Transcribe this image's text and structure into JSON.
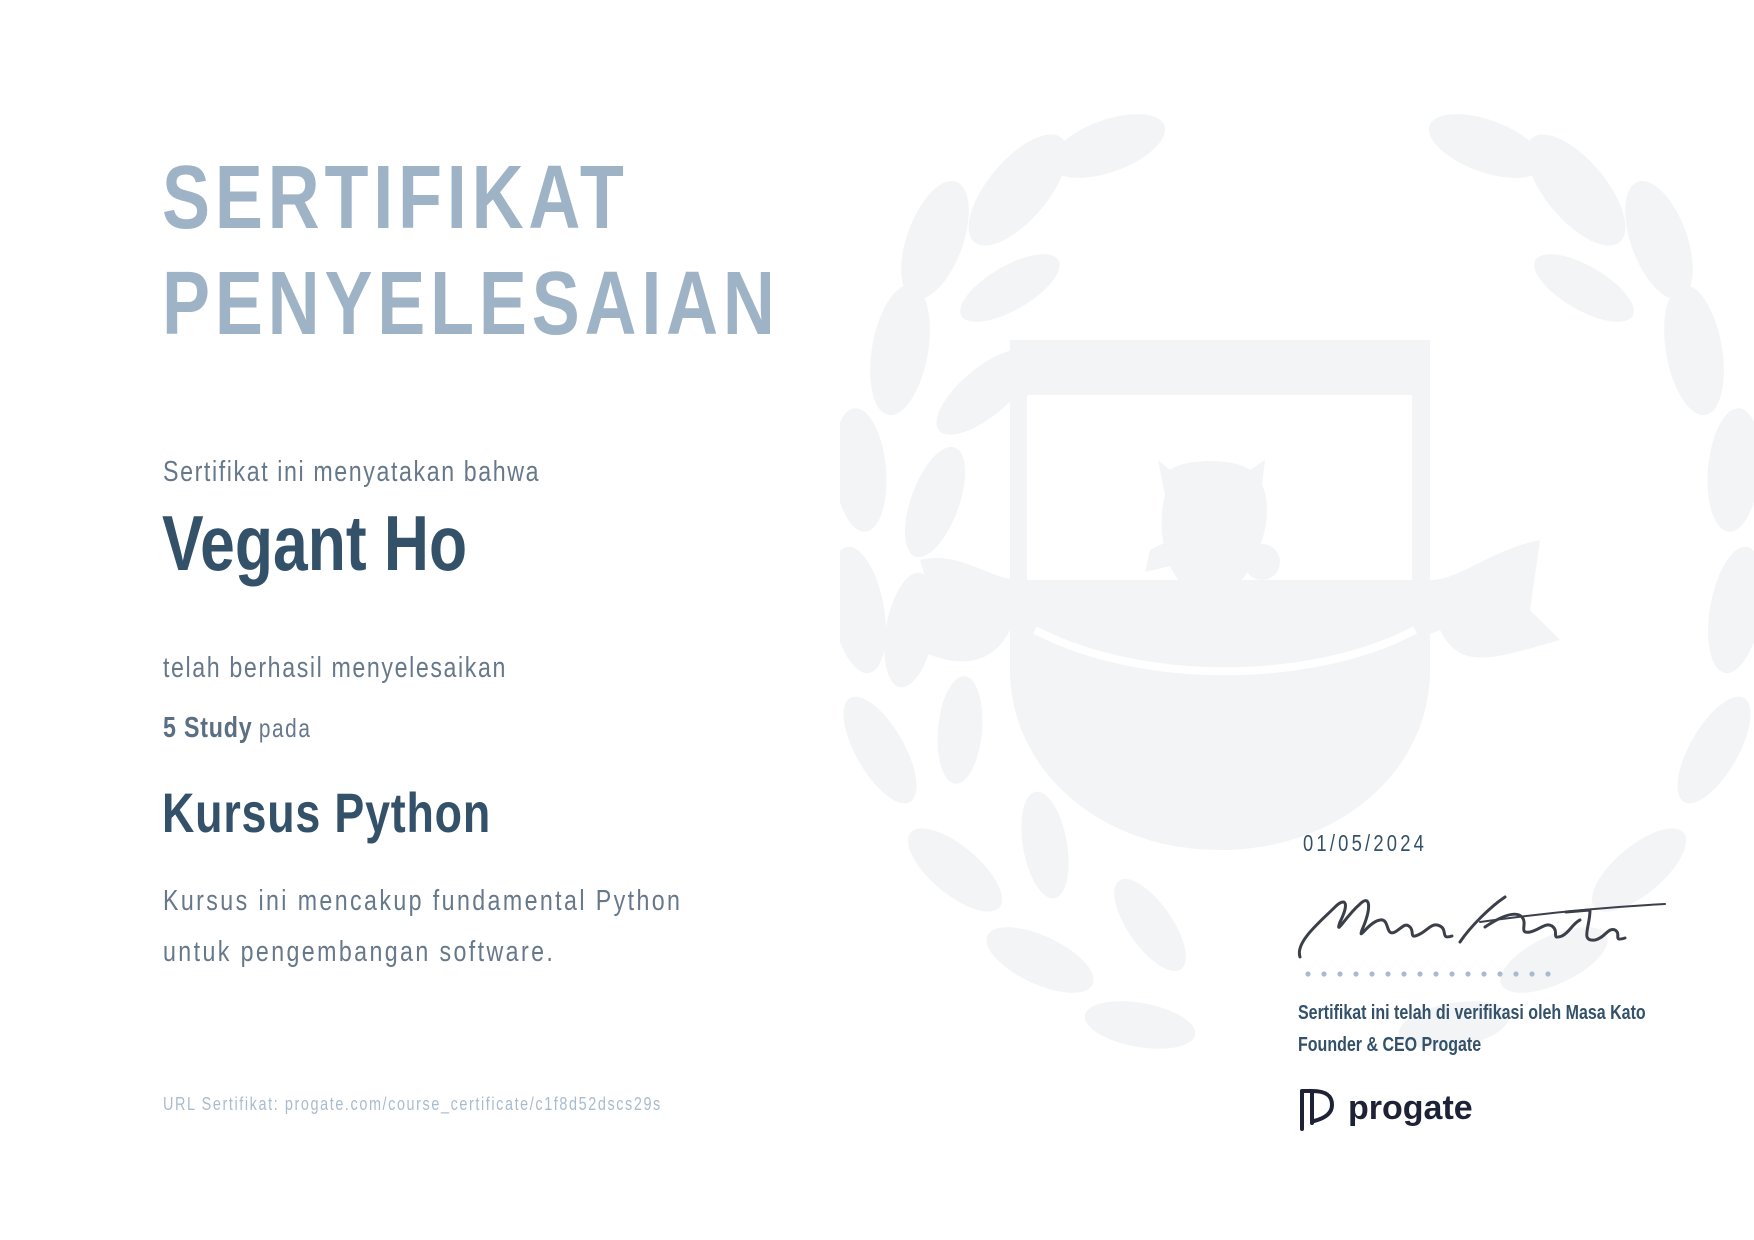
{
  "certificate": {
    "title_line1": "SERTIFIKAT",
    "title_line2": "PENYELESAIAN",
    "intro": "Sertifikat ini menyatakan bahwa",
    "recipient": "Vegant Ho",
    "completed_text": "telah berhasil menyelesaikan",
    "study_count": "5 Study",
    "study_suffix": "pada",
    "course_name": "Kursus Python",
    "description_line1": "Kursus ini mencakup fundamental Python",
    "description_line2": "untuk pengembangan software.",
    "url": "URL Sertifikat: progate.com/course_certificate/c1f8d52dscs29s",
    "date": "01/05/2024",
    "signature_text": "Masa Kato",
    "verification_line1": "Sertifikat ini telah di verifikasi oleh Masa Kato",
    "verification_line2": "Founder & CEO Progate",
    "brand": "progate"
  },
  "colors": {
    "title": "#9fb3c6",
    "heading": "#34516a",
    "body": "#66788a",
    "url": "#a9bccd",
    "watermark": "#f3f4f6",
    "signature": "#3a3f4a",
    "dots": "#aabbd0",
    "logo": "#1e2236"
  },
  "icons": {
    "watermark": "laurel-crest-icon",
    "logo": "progate-logo-icon"
  }
}
